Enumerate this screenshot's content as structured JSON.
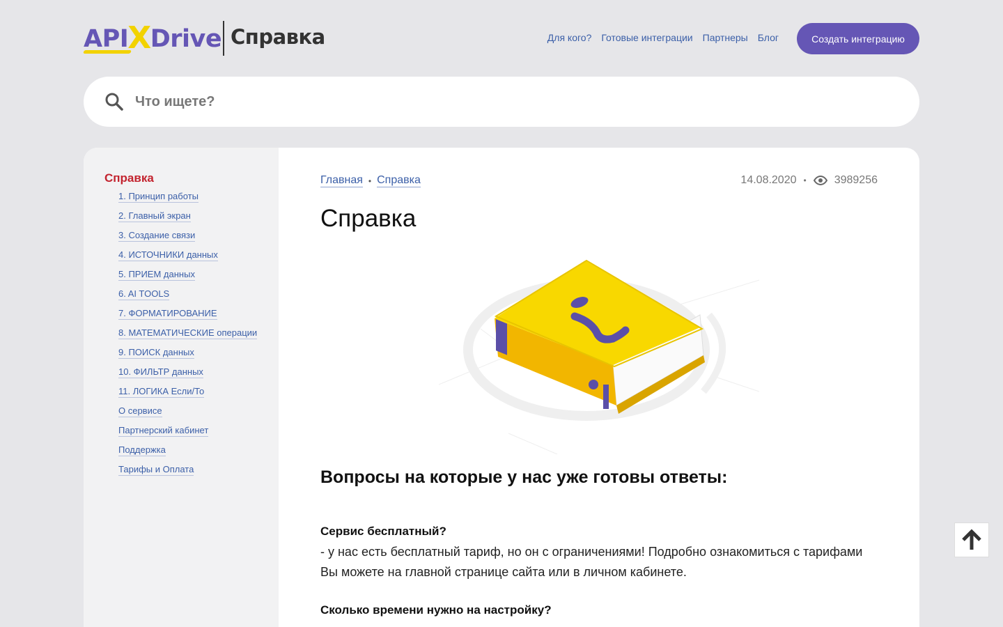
{
  "brand": {
    "api": "API",
    "x": "X",
    "drive": "Drive",
    "section": "Справка"
  },
  "nav": [
    {
      "label": "Для кого?"
    },
    {
      "label": "Готовые интеграции"
    },
    {
      "label": "Партнеры"
    },
    {
      "label": "Блог"
    }
  ],
  "cta_label": "Создать интеграцию",
  "search": {
    "placeholder": "Что ищете?"
  },
  "sidebar": {
    "title": "Справка",
    "items": [
      "1. Принцип работы",
      "2. Главный экран",
      "3. Создание связи",
      "4. ИСТОЧНИКИ данных",
      "5. ПРИЕМ данных",
      "6. AI TOOLS",
      "7. ФОРМАТИРОВАНИЕ",
      "8. МАТЕМАТИЧЕСКИЕ операции",
      "9. ПОИСК данных",
      "10. ФИЛЬТР данных",
      "11. ЛОГИКА Если/То",
      "О сервисе",
      "Партнерский кабинет",
      "Поддержка",
      "Тарифы и Оплата"
    ]
  },
  "breadcrumb": {
    "home": "Главная",
    "current": "Справка",
    "separator": "•"
  },
  "meta": {
    "date": "14.08.2020",
    "separator": "•",
    "views": "3989256"
  },
  "page_title": "Справка",
  "section_heading": "Вопросы на которые у нас уже готовы ответы:",
  "faq": [
    {
      "q": "Сервис бесплатный?",
      "a": "- у нас есть бесплатный тариф, но он с ограничениями! Подробно ознакомиться с тарифами Вы можете на главной странице сайта или в личном кабинете."
    },
    {
      "q": "Сколько времени нужно на настройку?",
      "a": ""
    }
  ],
  "colors": {
    "brand_purple": "#6556b5",
    "brand_yellow": "#f2d200",
    "link_blue": "#3b5fa8",
    "sidebar_title_red": "#c3242f"
  },
  "icons": {
    "search": "search-icon",
    "views": "eye-icon",
    "scroll_top": "arrow-up-icon"
  }
}
